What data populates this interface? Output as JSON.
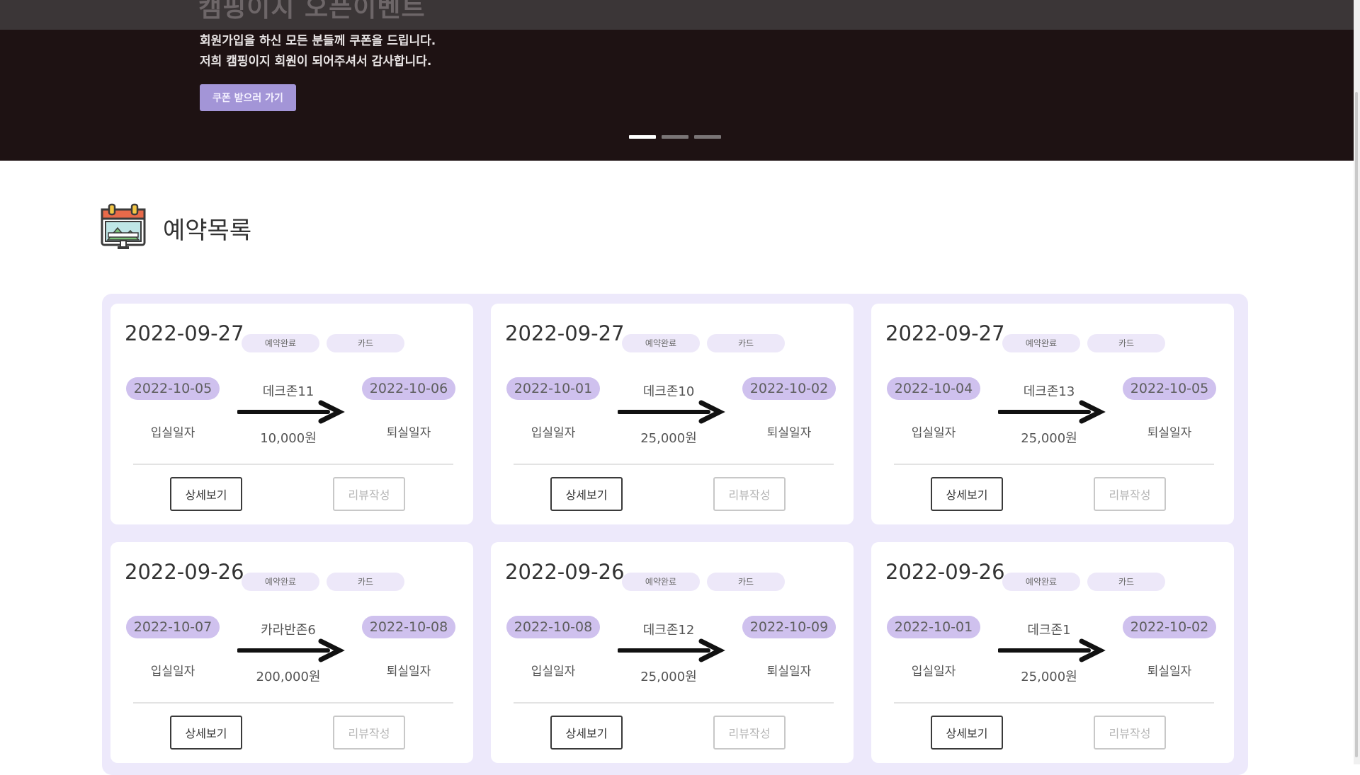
{
  "banner": {
    "title": "캠핑이지 오픈이벤트",
    "line1": "회원가입을 하신 모든 분들께 쿠폰을 드립니다.",
    "line2": "저희 캠핑이지 회원이 되어주셔서 감사합니다.",
    "button_label": "쿠폰 받으러 가기",
    "slide_count": 3,
    "active_slide": 1
  },
  "section": {
    "title": "예약목록",
    "icon": "calendar-icon"
  },
  "colors": {
    "accent": "#a395d7",
    "chip": "#cfc1ee",
    "pill": "#ede8f9",
    "panel": "#ede9fb",
    "banner_bg": "#1e1213"
  },
  "labels": {
    "check_in": "입실일자",
    "check_out": "퇴실일자",
    "detail_button": "상세보기",
    "review_button": "리뷰작성"
  },
  "reservations": [
    {
      "booked_date": "2022-09-27",
      "status": "예약완료",
      "payment": "카드",
      "check_in": "2022-10-05",
      "check_out": "2022-10-06",
      "site": "데크존11",
      "price": "10,000원"
    },
    {
      "booked_date": "2022-09-27",
      "status": "예약완료",
      "payment": "카드",
      "check_in": "2022-10-01",
      "check_out": "2022-10-02",
      "site": "데크존10",
      "price": "25,000원"
    },
    {
      "booked_date": "2022-09-27",
      "status": "예약완료",
      "payment": "카드",
      "check_in": "2022-10-04",
      "check_out": "2022-10-05",
      "site": "데크존13",
      "price": "25,000원"
    },
    {
      "booked_date": "2022-09-26",
      "status": "예약완료",
      "payment": "카드",
      "check_in": "2022-10-07",
      "check_out": "2022-10-08",
      "site": "카라반존6",
      "price": "200,000원"
    },
    {
      "booked_date": "2022-09-26",
      "status": "예약완료",
      "payment": "카드",
      "check_in": "2022-10-08",
      "check_out": "2022-10-09",
      "site": "데크존12",
      "price": "25,000원"
    },
    {
      "booked_date": "2022-09-26",
      "status": "예약완료",
      "payment": "카드",
      "check_in": "2022-10-01",
      "check_out": "2022-10-02",
      "site": "데크존1",
      "price": "25,000원"
    }
  ]
}
